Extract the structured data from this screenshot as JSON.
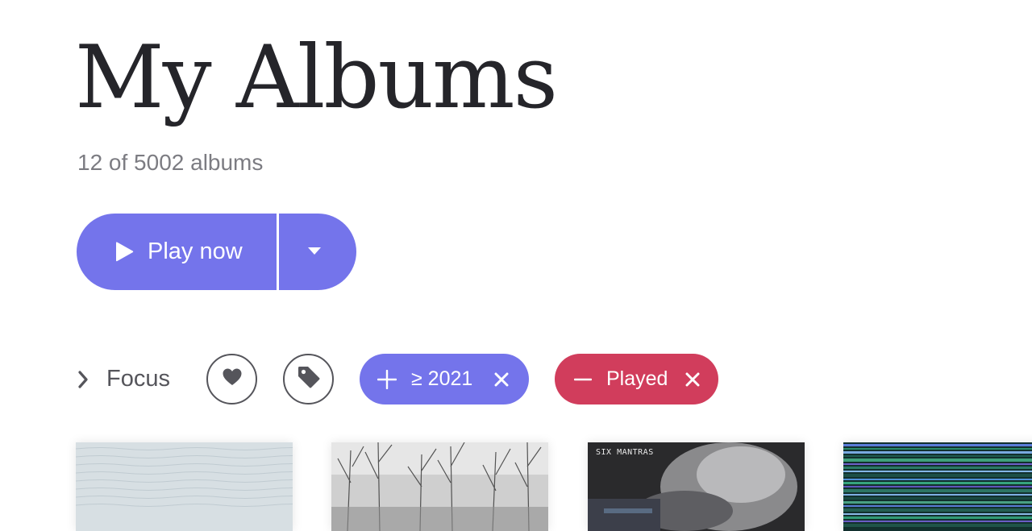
{
  "header": {
    "title": "My Albums",
    "subtitle": "12 of 5002 albums"
  },
  "actions": {
    "play_label": "Play now",
    "play_icon": "play-icon",
    "dropdown_icon": "caret-down-icon",
    "accent_color": "#7474eb"
  },
  "filters": {
    "focus_label": "Focus",
    "focus_icon": "chevron-right-icon",
    "favorite_icon": "heart-icon",
    "tag_icon": "tag-icon",
    "chips": [
      {
        "mode_icon": "plus-icon",
        "label": "≥ 2021",
        "remove_icon": "close-icon",
        "color": "#7474eb"
      },
      {
        "mode_icon": "minus-icon",
        "label": "Played",
        "remove_icon": "close-icon",
        "color": "#d13d5c"
      }
    ]
  },
  "albums": [
    {
      "cover_text": ""
    },
    {
      "cover_text": ""
    },
    {
      "cover_text": "SIX MANTRAS"
    },
    {
      "cover_text": ""
    }
  ]
}
